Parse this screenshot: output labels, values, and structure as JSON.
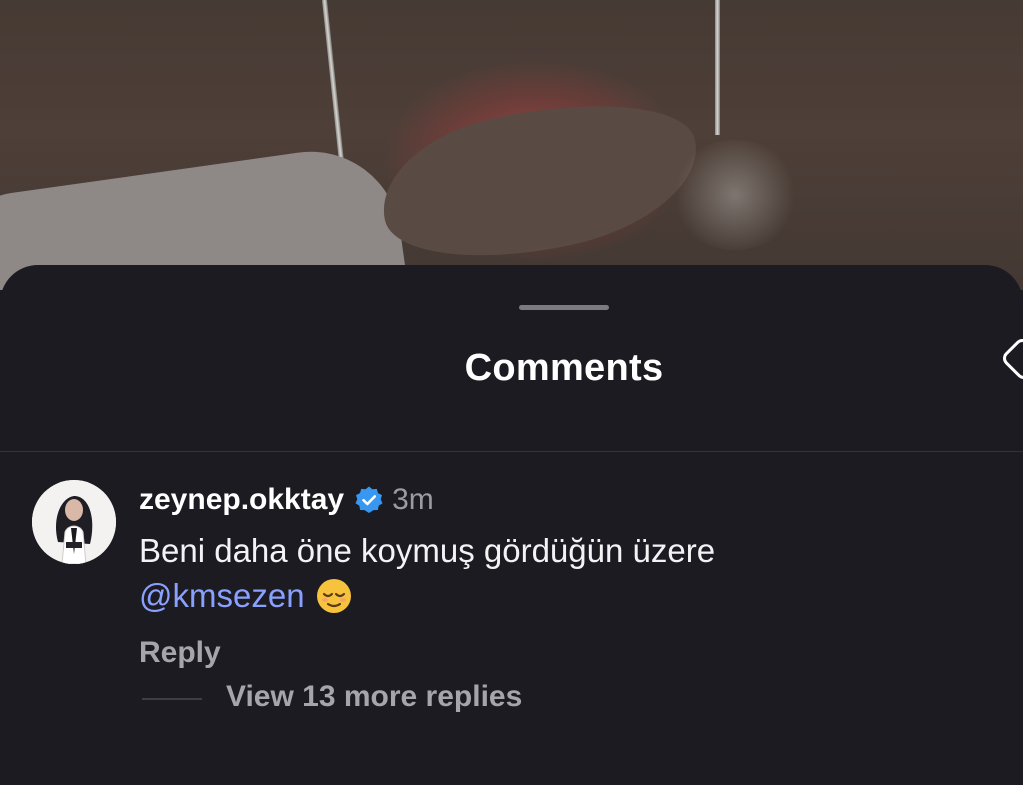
{
  "sheet": {
    "title": "Comments"
  },
  "comment": {
    "username": "zeynep.okktay",
    "verified": true,
    "time": "3m",
    "text": "Beni daha öne koymuş gördüğün üzere",
    "mention": "@kmsezen",
    "emoji": "😌",
    "reply_label": "Reply",
    "view_replies_label": "View 13 more replies"
  },
  "colors": {
    "accent_mention": "#8aa0ff",
    "verified_badge": "#3897f0",
    "sheet_background": "#1c1b21"
  },
  "icons": {
    "verified": "verified-badge-icon",
    "edge": "heart-outline-icon"
  }
}
